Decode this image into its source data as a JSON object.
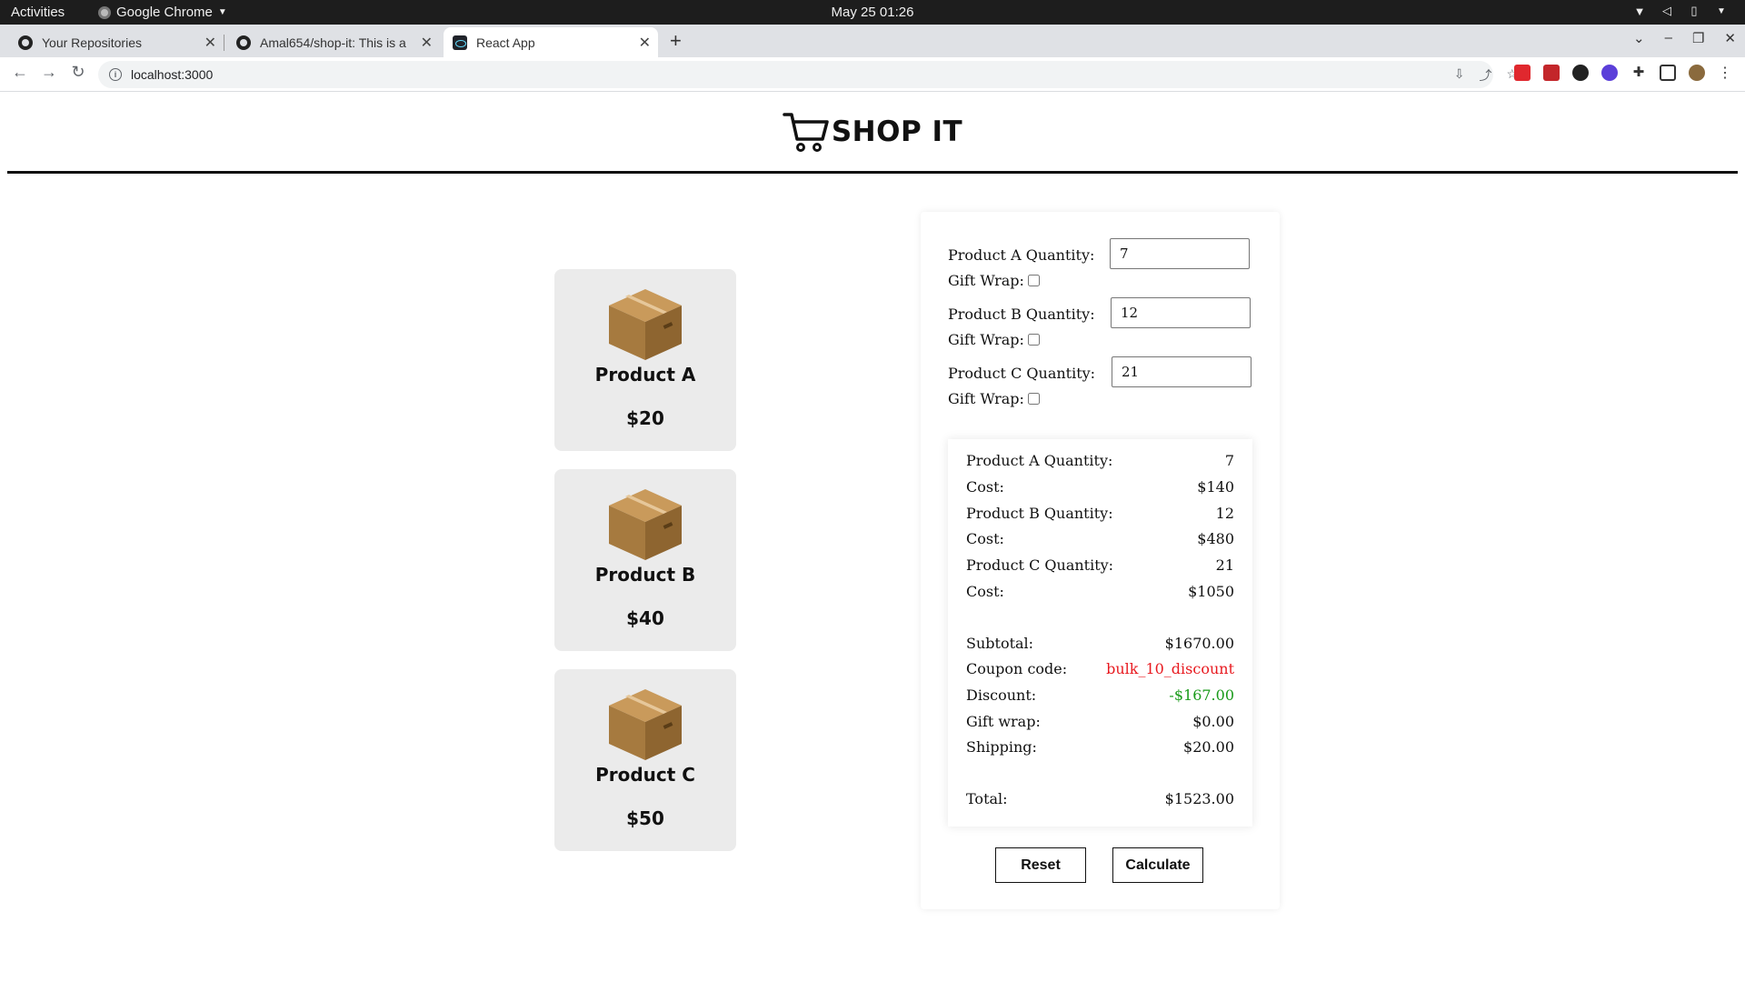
{
  "os_bar": {
    "activities": "Activities",
    "app_name": "Google Chrome",
    "clock": "May 25  01:26"
  },
  "browser": {
    "tabs": [
      {
        "title": "Your Repositories",
        "icon": "github-icon",
        "active": false
      },
      {
        "title": "Amal654/shop-it: This is a",
        "icon": "github-icon",
        "active": false
      },
      {
        "title": "React App",
        "icon": "react-icon",
        "active": true
      }
    ],
    "url": "localhost:3000"
  },
  "app": {
    "logo_text": "SHOP IT",
    "products": [
      {
        "name": "Product A",
        "price": "$20"
      },
      {
        "name": "Product B",
        "price": "$40"
      },
      {
        "name": "Product C",
        "price": "$50"
      }
    ],
    "form": {
      "rows": [
        {
          "label": "Product A Quantity:",
          "value": "7",
          "gift_label": "Gift Wrap:",
          "gift_checked": false
        },
        {
          "label": "Product B Quantity:",
          "value": "12",
          "gift_label": "Gift Wrap:",
          "gift_checked": false
        },
        {
          "label": "Product C Quantity:",
          "value": "21",
          "gift_label": "Gift Wrap:",
          "gift_checked": false
        }
      ]
    },
    "summary": {
      "lines": [
        {
          "label": "Product A Quantity:",
          "value": "7"
        },
        {
          "label": "Cost:",
          "value": "$140"
        },
        {
          "label": "Product B Quantity:",
          "value": "12"
        },
        {
          "label": "Cost:",
          "value": "$480"
        },
        {
          "label": "Product C Quantity:",
          "value": "21"
        },
        {
          "label": "Cost:",
          "value": "$1050"
        }
      ],
      "subtotal_label": "Subtotal:",
      "subtotal": "$1670.00",
      "coupon_label": "Coupon code:",
      "coupon": "bulk_10_discount",
      "discount_label": "Discount:",
      "discount": "-$167.00",
      "giftwrap_label": "Gift wrap:",
      "giftwrap": "$0.00",
      "shipping_label": "Shipping:",
      "shipping": "$20.00",
      "total_label": "Total:",
      "total": "$1523.00"
    },
    "buttons": {
      "reset": "Reset",
      "calculate": "Calculate"
    }
  }
}
